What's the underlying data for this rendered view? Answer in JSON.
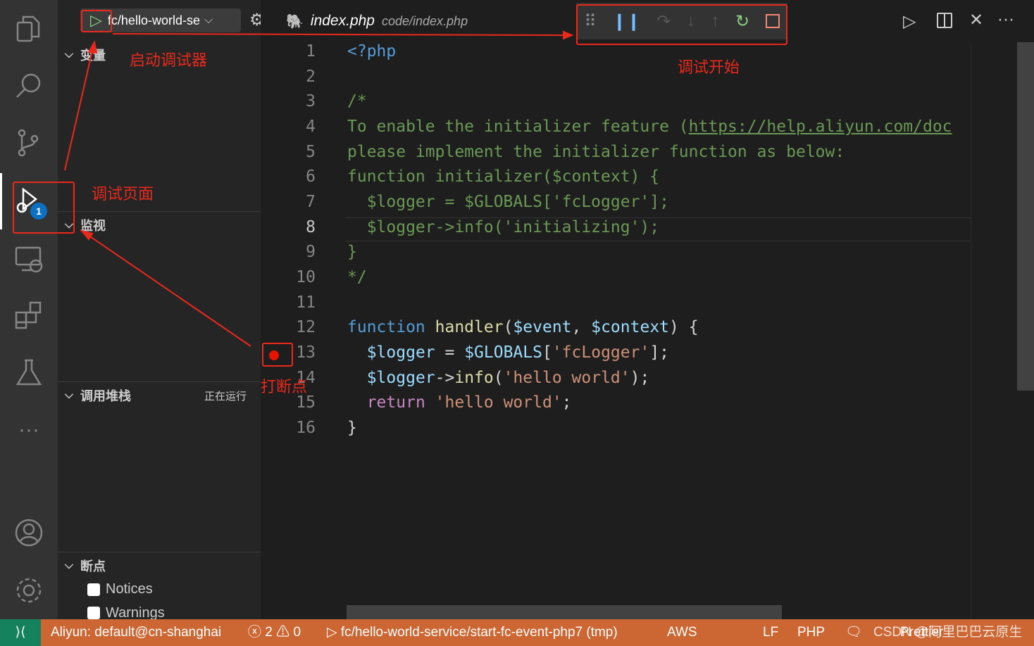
{
  "activity_bar": {
    "items": [
      "explorer-icon",
      "search-icon",
      "source-control-icon",
      "run-debug-icon",
      "remote-explorer-icon",
      "extensions-icon",
      "testing-icon",
      "more-icon",
      "account-icon",
      "settings-icon"
    ],
    "debug_badge": "1"
  },
  "debug_toolbar_top": {
    "config_name": "fc/hello-world-se"
  },
  "tab": {
    "title": "index.php",
    "path": "code/index.php"
  },
  "sidebar": {
    "variables": "变量",
    "watch": "监视",
    "callstack": "调用堆栈",
    "callstack_status": "正在运行",
    "breakpoints": "断点",
    "breakpoint_items": [
      {
        "label": "Notices",
        "checked": false
      },
      {
        "label": "Warnings",
        "checked": false
      }
    ]
  },
  "debug_controls": [
    "drag-handle-icon",
    "pause-icon",
    "step-over-icon",
    "step-into-icon",
    "step-out-icon",
    "restart-icon",
    "stop-icon"
  ],
  "annotations": {
    "start_debugger": "启动调试器",
    "debug_page": "调试页面",
    "debug_started": "调试开始",
    "set_breakpoint": "打断点"
  },
  "code_lines": [
    [
      [
        "<?php",
        "kw"
      ]
    ],
    [],
    [
      [
        "/*",
        "cm"
      ]
    ],
    [
      [
        "To enable the initializer feature (",
        "cm"
      ],
      [
        "https://help.aliyun.com/doc",
        "lnk"
      ]
    ],
    [
      [
        "please implement the initializer function as below:",
        "cm"
      ]
    ],
    [
      [
        "function initializer($context) {",
        "cm"
      ]
    ],
    [
      [
        "  $logger = $GLOBALS['fcLogger'];",
        "cm"
      ]
    ],
    [
      [
        "  $logger->info('initializing');",
        "cm"
      ]
    ],
    [
      [
        "}",
        "cm"
      ]
    ],
    [
      [
        "*/",
        "cm"
      ]
    ],
    [],
    [
      [
        "function",
        "kw"
      ],
      [
        " ",
        "pl"
      ],
      [
        "handler",
        "fn"
      ],
      [
        "(",
        "pl"
      ],
      [
        "$event",
        "vr"
      ],
      [
        ", ",
        "pl"
      ],
      [
        "$context",
        "vr"
      ],
      [
        ") {",
        "pl"
      ]
    ],
    [
      [
        "  ",
        "pl"
      ],
      [
        "$logger",
        "vr"
      ],
      [
        " = ",
        "pl"
      ],
      [
        "$GLOBALS",
        "vr"
      ],
      [
        "[",
        "pl"
      ],
      [
        "'fcLogger'",
        "st"
      ],
      [
        "];",
        "pl"
      ]
    ],
    [
      [
        "  ",
        "pl"
      ],
      [
        "$logger",
        "vr"
      ],
      [
        "->",
        "pl"
      ],
      [
        "info",
        "fn"
      ],
      [
        "(",
        "pl"
      ],
      [
        "'hello world'",
        "st"
      ],
      [
        ");",
        "pl"
      ]
    ],
    [
      [
        "  ",
        "pl"
      ],
      [
        "return",
        "rt"
      ],
      [
        " ",
        "pl"
      ],
      [
        "'hello world'",
        "st"
      ],
      [
        ";",
        "pl"
      ]
    ],
    [
      [
        "}",
        "pl"
      ]
    ]
  ],
  "breakpoint_line": 13,
  "current_line": 8,
  "status_bar": {
    "remote": "remote-icon",
    "aliyun": "Aliyun: default@cn-shanghai",
    "errors": "2",
    "warnings": "0",
    "debug_session": "fc/hello-world-service/start-fc-event-php7 (tmp)",
    "aws": "AWS",
    "eol": "LF",
    "language": "PHP",
    "prettier": "Prettier",
    "watermark": "CSDN @阿里巴巴云原生"
  },
  "colors": {
    "status_bar": "#cc6633",
    "remote": "#16825d",
    "annotation": "#e8291c"
  }
}
